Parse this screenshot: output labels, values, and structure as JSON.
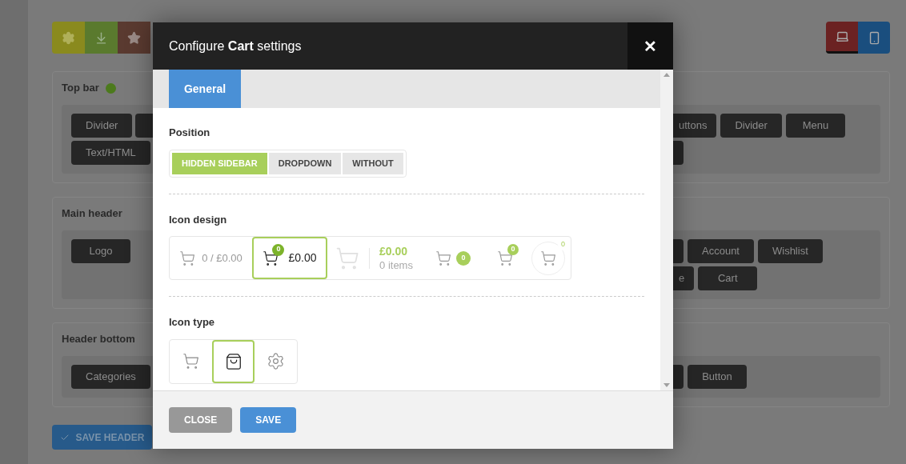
{
  "toolbar_buttons": [
    {
      "kind": "gear"
    },
    {
      "kind": "download"
    },
    {
      "kind": "star"
    }
  ],
  "device_tabs": [
    {
      "kind": "desktop",
      "selected": true
    },
    {
      "kind": "mobile",
      "selected": false
    }
  ],
  "sections": [
    {
      "title": "Top bar",
      "active": true,
      "left_rows": [
        [
          {
            "kind": "button",
            "label": "Divider"
          },
          {
            "kind": "covered"
          }
        ],
        [
          {
            "kind": "button",
            "label": "Text/HTML"
          }
        ]
      ],
      "right_rows": [
        [
          {
            "kind": "cut",
            "label": "uttons"
          },
          {
            "kind": "button",
            "label": "Divider"
          },
          {
            "kind": "button",
            "label": "Menu"
          }
        ],
        [
          {
            "kind": "covered"
          }
        ]
      ]
    },
    {
      "title": "Main header",
      "active": false,
      "left_rows": [
        [
          {
            "kind": "button",
            "label": "Logo"
          }
        ]
      ],
      "right_rows": [
        [
          {
            "kind": "covered"
          },
          {
            "kind": "button",
            "label": "Account"
          },
          {
            "kind": "button",
            "label": "Wishlist"
          }
        ],
        [
          {
            "kind": "cut",
            "label": "e"
          },
          {
            "kind": "button",
            "label": "Cart"
          }
        ]
      ]
    },
    {
      "title": "Header bottom",
      "active": false,
      "left_rows": [
        [
          {
            "kind": "button",
            "label": "Categories"
          }
        ]
      ],
      "right_rows": [
        [
          {
            "kind": "covered"
          },
          {
            "kind": "button",
            "label": "Button"
          }
        ]
      ]
    }
  ],
  "save_header": {
    "label": "SAVE HEADER"
  },
  "modal": {
    "title": "Configure **Cart** settings",
    "close": "✕",
    "tabs": [
      {
        "label": "General",
        "selected": true
      }
    ],
    "position": {
      "label": "Position",
      "options": [
        {
          "label": "HIDDEN SIDEBAR",
          "selected": true
        },
        {
          "label": "DROPDOWN",
          "selected": false
        },
        {
          "label": "WITHOUT",
          "selected": false
        }
      ]
    },
    "icon_design": {
      "label": "Icon design",
      "options": [
        {
          "kind": "slash",
          "text": "0 / £0.00",
          "selected": false
        },
        {
          "kind": "badge",
          "count": "0",
          "text": "£0.00",
          "selected": true
        },
        {
          "kind": "stacked",
          "text": "£0.00",
          "subtext": "0 items",
          "selected": false
        },
        {
          "kind": "pill",
          "count": "0",
          "selected": false
        },
        {
          "kind": "light-badge",
          "count": "0",
          "selected": false
        },
        {
          "kind": "circle",
          "count": "0",
          "selected": false
        }
      ]
    },
    "icon_type": {
      "label": "Icon type",
      "options": [
        {
          "kind": "cart",
          "selected": false
        },
        {
          "kind": "bag",
          "selected": true
        },
        {
          "kind": "gear",
          "selected": false
        }
      ]
    },
    "footer_buttons": [
      {
        "kind": "secondary",
        "label": "CLOSE"
      },
      {
        "kind": "primary",
        "label": "SAVE"
      }
    ]
  }
}
